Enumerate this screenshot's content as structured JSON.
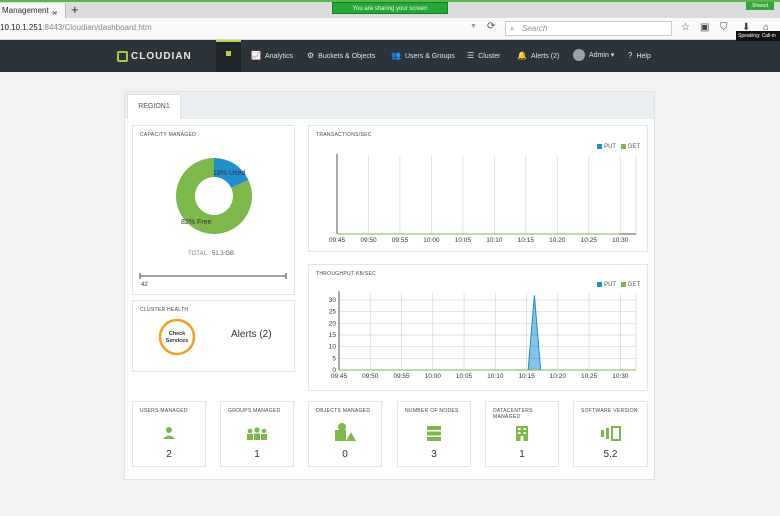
{
  "browser": {
    "tab_title": "Management ...",
    "tab_close": "×",
    "new_tab": "+",
    "sharing_banner": "You are sharing your screen",
    "shared_tag": "Shared",
    "url_host": "10.10.1.251",
    "url_path": ":8443/Cloudian/dashboard.htm",
    "search_placeholder": "Search",
    "speaking_tooltip": "Speaking: Call-in"
  },
  "nav": {
    "logo": "CLOUDIAN",
    "items": [
      {
        "label": "Analytics",
        "icon": "chart-icon",
        "glyph": "📈"
      },
      {
        "label": "Buckets & Objects",
        "icon": "gear-icon",
        "glyph": "⚙"
      },
      {
        "label": "Users & Groups",
        "icon": "users-icon",
        "glyph": "👥"
      },
      {
        "label": "Cluster",
        "icon": "list-icon",
        "glyph": "☰"
      },
      {
        "label": "Alerts (2)",
        "icon": "bell-icon",
        "glyph": "🔔"
      },
      {
        "label": "Admin ▾",
        "icon": "avatar-icon",
        "glyph": ""
      },
      {
        "label": "Help",
        "icon": "help-icon",
        "glyph": "?"
      }
    ]
  },
  "region_tab": "REGION1",
  "capacity": {
    "title": "CAPACITY MANAGED",
    "used_pct": 18,
    "free_pct": 82,
    "used_label": "18% Used",
    "free_label": "82% Free",
    "total_label": "TOTAL",
    "total_value": "51.3 GB",
    "slider_value": "42",
    "colors": {
      "used": "#1f8fd1",
      "free": "#7cb94a"
    }
  },
  "cluster_health": {
    "title": "CLUSTER HEALTH",
    "check_line1": "Check",
    "check_line2": "Services",
    "alerts": "Alerts (2)"
  },
  "chart_data": [
    {
      "type": "line",
      "title": "TRANSACTIONS/SEC",
      "categories": [
        "09:45",
        "09:50",
        "09:55",
        "10:00",
        "10:05",
        "10:10",
        "10:15",
        "10:20",
        "10:25",
        "10:30"
      ],
      "series": [
        {
          "name": "PUT",
          "color": "#1f8fd1",
          "values": [
            0,
            0,
            0,
            0,
            0,
            0,
            0,
            0,
            0,
            0
          ]
        },
        {
          "name": "GET",
          "color": "#7cb94a",
          "values": [
            0,
            0,
            0,
            0,
            0,
            0,
            0,
            0,
            0,
            0
          ]
        }
      ],
      "legend": "top-right",
      "grid": "vertical"
    },
    {
      "type": "area",
      "title": "THROUGHPUT KB/SEC",
      "categories": [
        "09:45",
        "09:50",
        "09:55",
        "10:00",
        "10:05",
        "10:10",
        "10:15",
        "10:20",
        "10:25",
        "10:30"
      ],
      "yticks": [
        "0",
        "5",
        "10",
        "15",
        "20",
        "25",
        "30"
      ],
      "ylim": [
        0,
        33
      ],
      "series": [
        {
          "name": "PUT",
          "color": "#1f8fd1",
          "points": [
            [
              0,
              0
            ],
            [
              6.05,
              0
            ],
            [
              6.25,
              32
            ],
            [
              6.45,
              0
            ],
            [
              9.5,
              0
            ]
          ]
        },
        {
          "name": "GET",
          "color": "#7cb94a",
          "points": [
            [
              0,
              0
            ],
            [
              9.5,
              0
            ]
          ]
        }
      ],
      "legend": "top-right",
      "grid": "both"
    }
  ],
  "stats": [
    {
      "title": "USERS MANAGED",
      "value": "2",
      "icon": "user-icon"
    },
    {
      "title": "GROUPS MANAGED",
      "value": "1",
      "icon": "group-icon"
    },
    {
      "title": "OBJECTS MANAGED",
      "value": "0",
      "icon": "shapes-icon"
    },
    {
      "title": "NUMBER OF NODES",
      "value": "3",
      "icon": "server-icon"
    },
    {
      "title": "DATACENTERS MANAGED",
      "value": "1",
      "icon": "building-icon"
    },
    {
      "title": "SOFTWARE VERSION",
      "value": "5.2",
      "icon": "version-icon"
    }
  ],
  "accent": "#7cb94a"
}
